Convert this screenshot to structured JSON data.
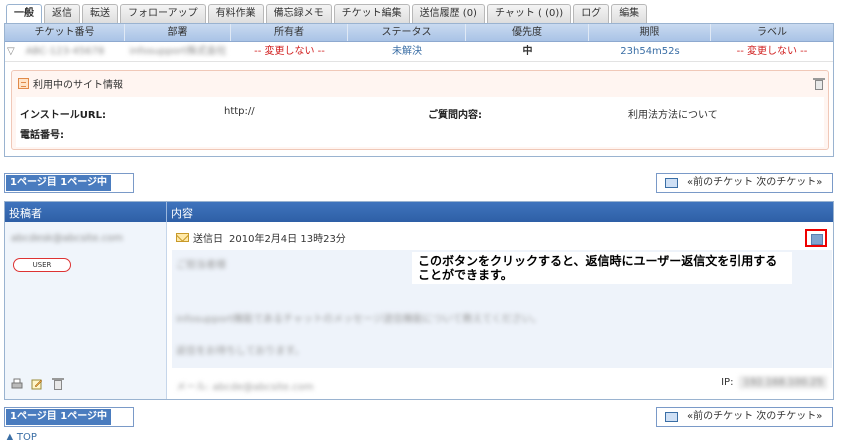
{
  "tabs": [
    {
      "label": "一般",
      "active": true
    },
    {
      "label": "返信"
    },
    {
      "label": "転送"
    },
    {
      "label": "フォローアップ"
    },
    {
      "label": "有料作業"
    },
    {
      "label": "備忘録メモ"
    },
    {
      "label": "チケット編集"
    },
    {
      "label": "送信履歴 (0)"
    },
    {
      "label": "チャット (  (0))"
    },
    {
      "label": "ログ"
    },
    {
      "label": "編集"
    }
  ],
  "ticket": {
    "columns": [
      "チケット番号",
      "部署",
      "所有者",
      "ステータス",
      "優先度",
      "期限",
      "ラベル"
    ],
    "row": {
      "number": "ABC-123-45678",
      "department": "infosupport株式会社",
      "owner": "-- 変更しない --",
      "status": "未解決",
      "priority": "中",
      "deadline": "23h54m52s",
      "label": "-- 変更しない --"
    }
  },
  "site_info": {
    "title": "利用中のサイト情報",
    "install_url_label": "インストールURL:",
    "install_url_value": "http://",
    "question_label": "ご質問内容:",
    "question_value": "利用法方法について",
    "phone_label": "電話番号:"
  },
  "pager": {
    "label": "1ページ目 1ページ中"
  },
  "ticket_nav": {
    "label": "«前のチケット  次のチケット»"
  },
  "messages": {
    "col_author": "投稿者",
    "col_content": "内容",
    "author_email": "abcdesk@abcsite.com",
    "user_badge": "USER",
    "sent_label": "送信日",
    "sent_value": "2010年2月4日 13時23分",
    "callout": "このボタンをクリックすると、返信時にユーザー返信文を引用することができます。",
    "body_lines": [
      "ご担当者様",
      "infosupport機能であるチャットのメッセージ送信機能について教えてください。",
      "返信をお待ちしております。",
      "メール: abcde@abcsite.com"
    ],
    "ip_label": "IP:",
    "ip_value": "192.168.100.25"
  },
  "footer_link": "▲ TOP"
}
